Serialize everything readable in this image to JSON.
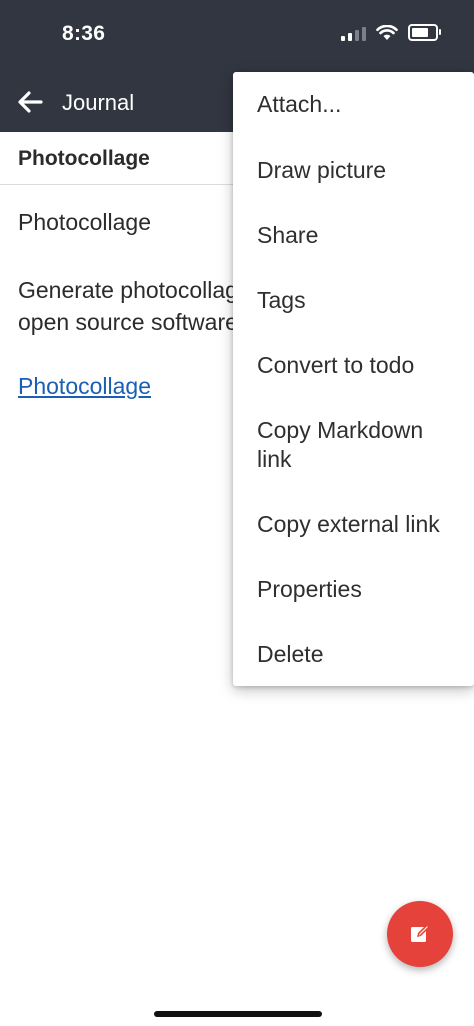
{
  "status_bar": {
    "time": "8:36"
  },
  "app_bar": {
    "title": "Journal"
  },
  "note": {
    "title": "Photocollage",
    "heading": "Photocollage",
    "description": "Generate photocollages from images, open source software.",
    "link_text": "Photocollage"
  },
  "menu": {
    "items": [
      "Attach...",
      "Draw picture",
      "Share",
      "Tags",
      "Convert to todo",
      "Copy Markdown link",
      "Copy external link",
      "Properties",
      "Delete"
    ]
  },
  "fab": {
    "icon": "edit-icon"
  },
  "colors": {
    "header": "#313640",
    "link": "#1a5fb4",
    "fab": "#e5423b"
  }
}
